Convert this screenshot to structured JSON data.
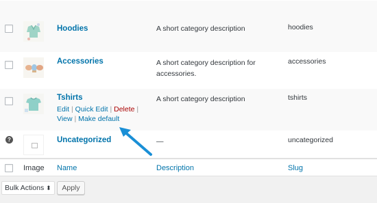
{
  "rows": [
    {
      "name": "Hoodies",
      "description": "A short category description",
      "slug": "hoodies"
    },
    {
      "name": "Accessories",
      "description": "A short category description for accessories.",
      "slug": "accessories"
    },
    {
      "name": "Tshirts",
      "description": "A short category description",
      "slug": "tshirts",
      "actions": {
        "edit": "Edit",
        "quick_edit": "Quick Edit",
        "delete": "Delete",
        "view": "View",
        "make_default": "Make default",
        "sep": "|"
      }
    },
    {
      "name": "Uncategorized",
      "description": "—",
      "slug": "uncategorized",
      "help": "?"
    }
  ],
  "footer": {
    "image": "Image",
    "name": "Name",
    "description": "Description",
    "slug": "Slug"
  },
  "bulk_actions": {
    "label": "Bulk Actions",
    "arrow": "⬍"
  },
  "apply_label": "Apply",
  "annotation": {
    "arrow_color": "#1a8fd6"
  }
}
